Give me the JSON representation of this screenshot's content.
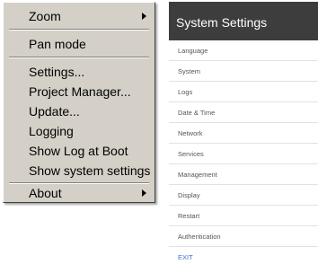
{
  "context_menu": {
    "items": [
      {
        "label": "Zoom",
        "has_submenu": true
      },
      {
        "label": "Pan mode"
      },
      {
        "label": "Settings..."
      },
      {
        "label": "Project Manager..."
      },
      {
        "label": "Update..."
      },
      {
        "label": "Logging"
      },
      {
        "label": "Show Log at Boot"
      },
      {
        "label": "Show system settings"
      },
      {
        "label": "About",
        "has_submenu": true
      }
    ]
  },
  "settings_panel": {
    "title": "System Settings",
    "items": [
      {
        "label": "Language"
      },
      {
        "label": "System"
      },
      {
        "label": "Logs"
      },
      {
        "label": "Date & Time"
      },
      {
        "label": "Network"
      },
      {
        "label": "Services"
      },
      {
        "label": "Management"
      },
      {
        "label": "Display"
      },
      {
        "label": "Restart"
      },
      {
        "label": "Authentication"
      },
      {
        "label": "EXIT"
      }
    ]
  },
  "colors": {
    "menu_background": "#d4d0c8",
    "header_background": "#3d3d3d",
    "exit_link": "#3a6ed8"
  }
}
